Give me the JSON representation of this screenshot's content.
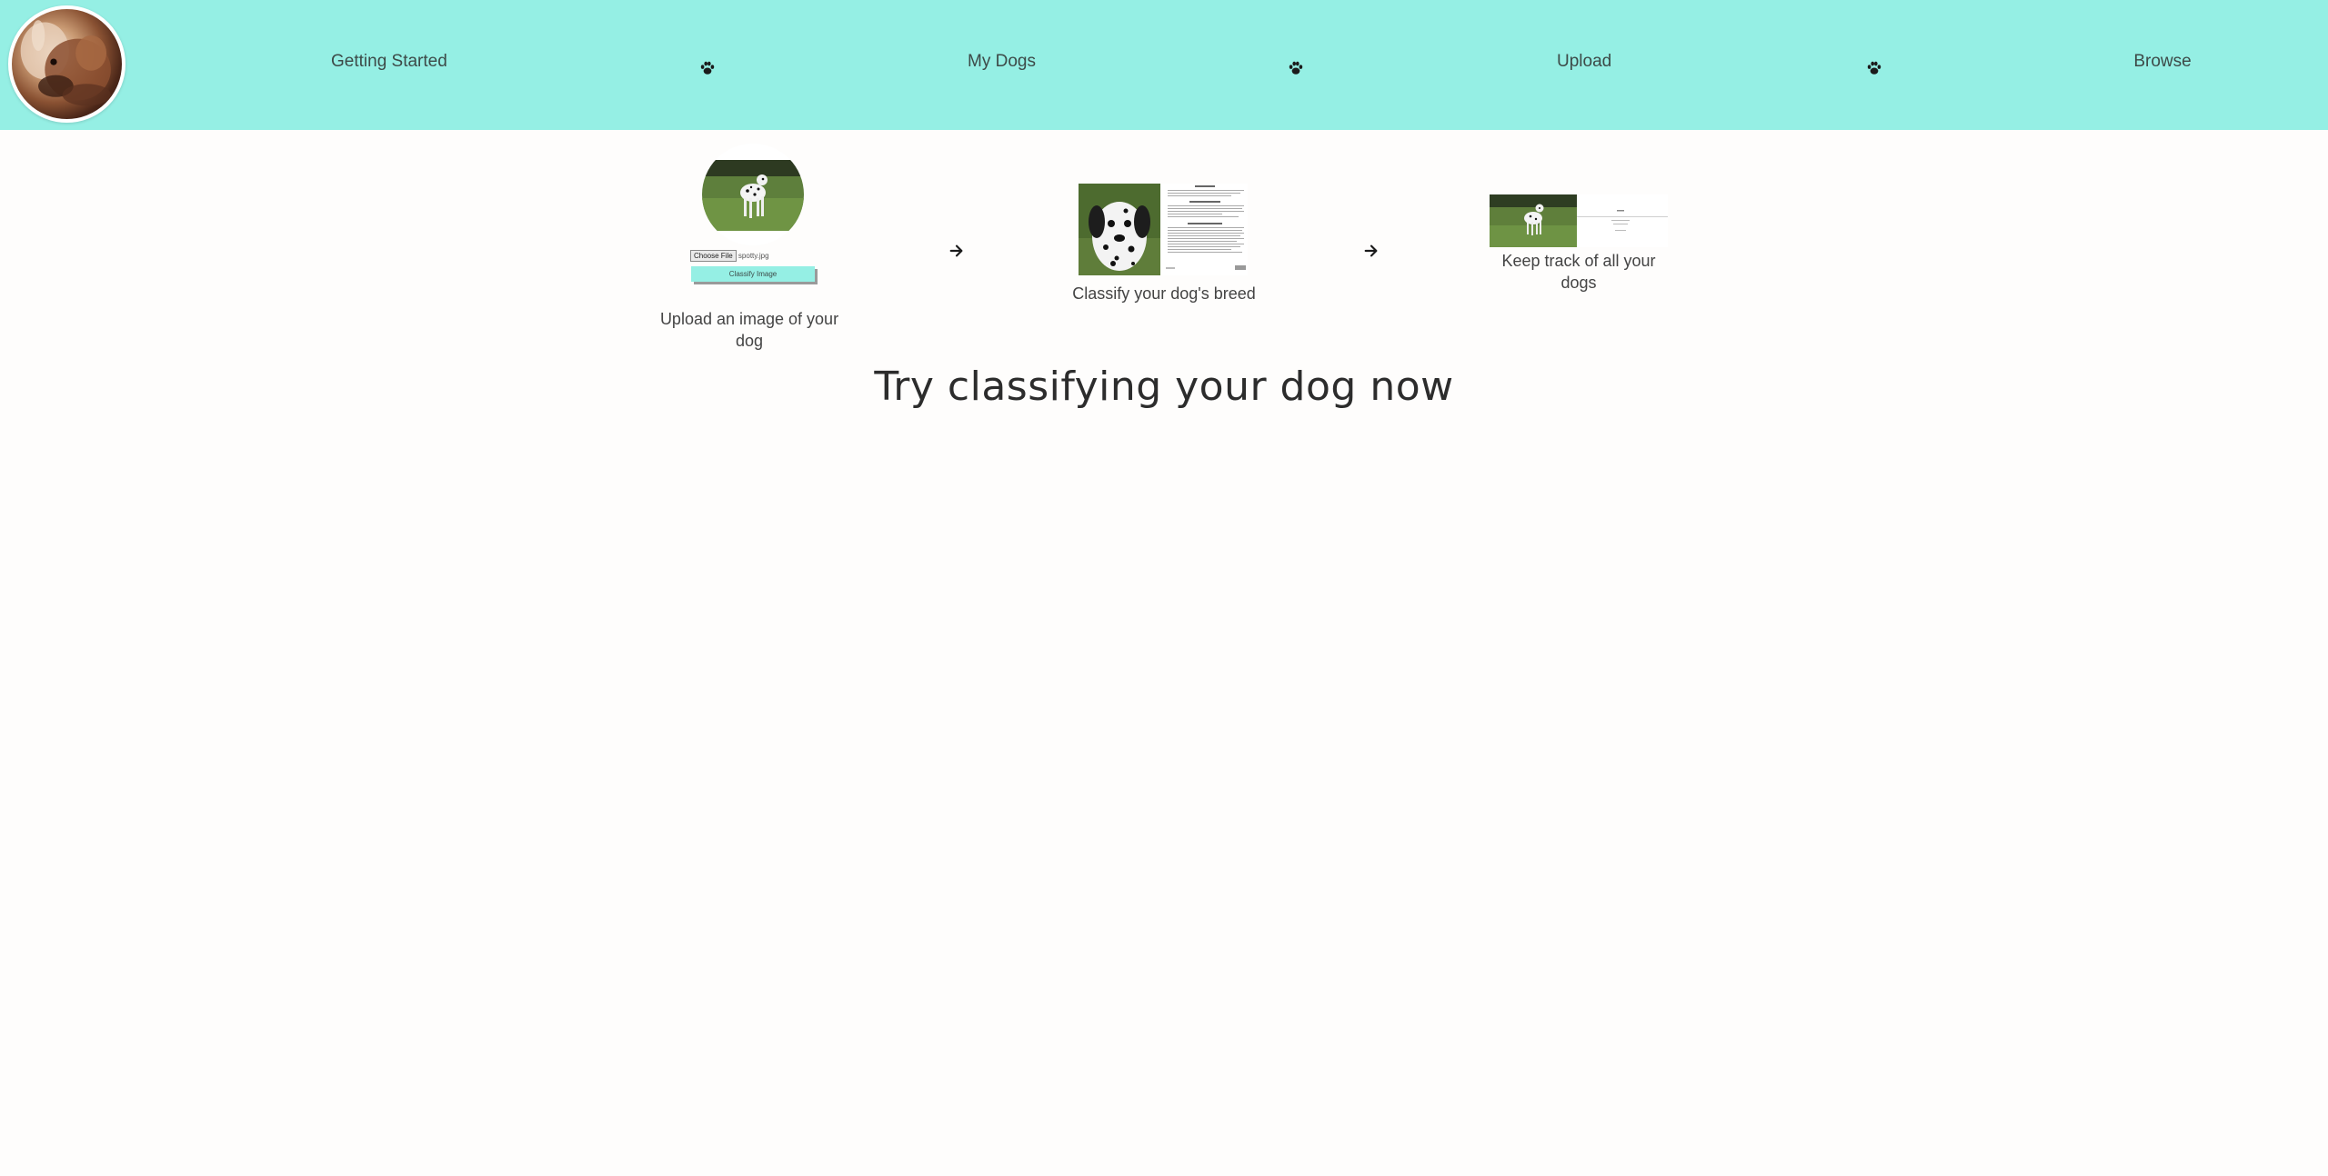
{
  "header": {
    "logo_icon": "dog-portrait-logo",
    "nav": [
      {
        "label": "Getting Started"
      },
      {
        "label": "My Dogs"
      },
      {
        "label": "Upload"
      },
      {
        "label": "Browse"
      }
    ],
    "separator_icon": "paw-icon",
    "background": "#95efe4"
  },
  "steps": [
    {
      "caption": "Upload an image of your dog",
      "mock": {
        "choose_file_label": "Choose File",
        "file_name": "spotty.jpg",
        "classify_button_label": "Classify Image"
      }
    },
    {
      "caption": "Classify your dog's breed"
    },
    {
      "caption": "Keep track of all your dogs"
    }
  ],
  "arrow_icon": "arrow-right-icon",
  "headline": "Try classifying your dog now"
}
